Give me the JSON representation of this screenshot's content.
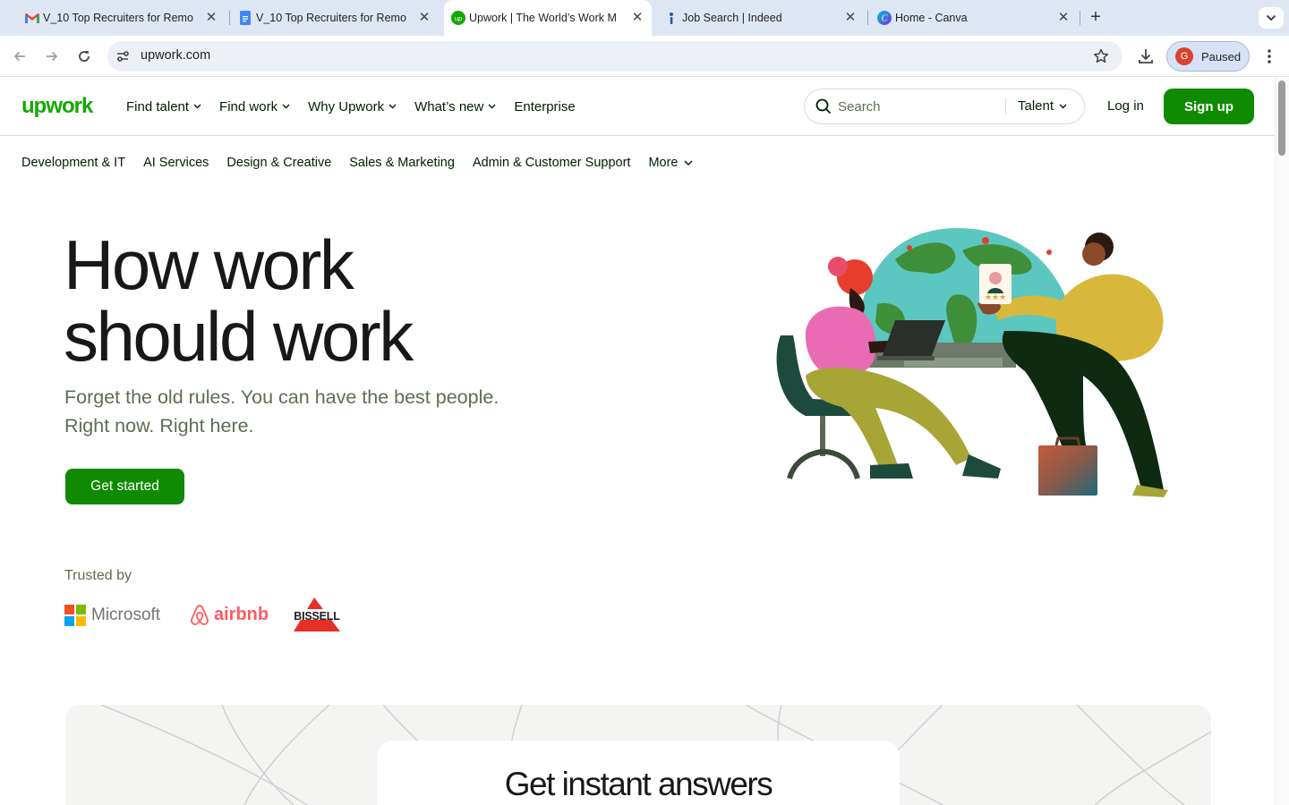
{
  "browser": {
    "tabs": [
      {
        "title": "V_10 Top Recruiters for Remo",
        "icon": "gmail-icon",
        "active": false
      },
      {
        "title": "V_10 Top Recruiters for Remo",
        "icon": "docs-icon",
        "active": false
      },
      {
        "title": "Upwork | The World’s Work M",
        "icon": "upwork-icon",
        "active": true
      },
      {
        "title": "Job Search | Indeed",
        "icon": "indeed-icon",
        "active": false
      },
      {
        "title": "Home - Canva",
        "icon": "canva-icon",
        "active": false
      }
    ],
    "url": "upwork.com",
    "profile": {
      "initial": "G",
      "label": "Paused"
    }
  },
  "header": {
    "nav": [
      {
        "label": "Find talent",
        "dropdown": true
      },
      {
        "label": "Find work",
        "dropdown": true
      },
      {
        "label": "Why Upwork",
        "dropdown": true
      },
      {
        "label": "What’s new",
        "dropdown": true
      },
      {
        "label": "Enterprise",
        "dropdown": false
      }
    ],
    "search": {
      "placeholder": "Search",
      "scope": "Talent"
    },
    "login": "Log in",
    "signup": "Sign up"
  },
  "categories": {
    "items": [
      "Development & IT",
      "AI Services",
      "Design & Creative",
      "Sales & Marketing",
      "Admin & Customer Support"
    ],
    "more": "More"
  },
  "hero": {
    "headline_line1": "How work",
    "headline_line2": "should work",
    "subline_line1": "Forget the old rules. You can have the best people.",
    "subline_line2": "Right now. Right here.",
    "cta": "Get started"
  },
  "trusted": {
    "label": "Trusted by",
    "brands": [
      "Microsoft",
      "airbnb",
      "BISSELL"
    ]
  },
  "promo": {
    "title": "Get instant answers"
  },
  "colors": {
    "brand_green": "#108a00",
    "logo_green": "#14a800",
    "text": "#001e00",
    "muted": "#5e6d55"
  }
}
